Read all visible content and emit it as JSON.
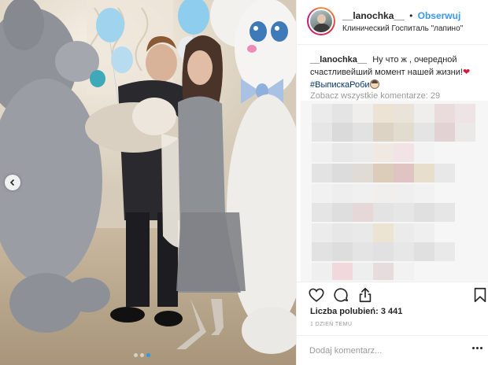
{
  "photo": {
    "alt_icons": [
      "bunny-mascot",
      "grey-mascot",
      "balloons"
    ],
    "carousel": {
      "total": 3,
      "active": 3
    }
  },
  "header": {
    "username": "__lanochka__",
    "bullet": "•",
    "follow_label": "Obserwuj",
    "location": "Клинический Госпиталь \"лапино\""
  },
  "caption": {
    "username": "__lanochka__",
    "text": "Ну что ж , очередной счастливейший момент нашей жизни!",
    "heart": "❤",
    "hashtag": "#ВыпискаРоби"
  },
  "comments": {
    "view_all_label": "Zobacz wszystkie komentarze: 29"
  },
  "actions": {
    "icons": [
      "heart-outline-icon",
      "comment-icon",
      "share-icon",
      "bookmark-icon"
    ]
  },
  "likes": {
    "label": "Liczba polubień: 3 441"
  },
  "timestamp": "1 DZIEŃ TEMU",
  "add_comment": {
    "placeholder": "Dodaj komentarz..."
  },
  "colors": {
    "follow": "#3897f0",
    "muted": "#999999",
    "text": "#262626",
    "border": "#efefef",
    "carousel_active": "#2e9ae8"
  }
}
